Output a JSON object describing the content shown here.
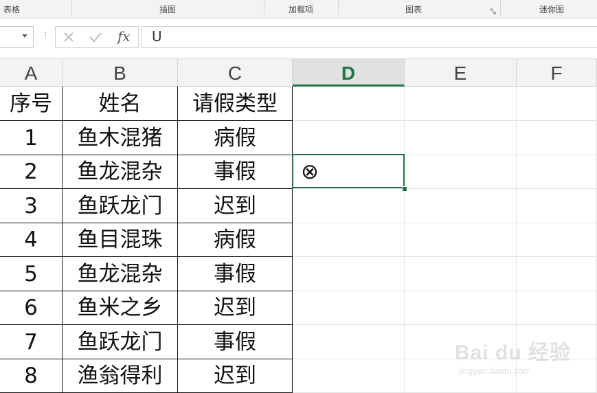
{
  "ribbon": {
    "groups": [
      "表格",
      "插图",
      "加载项",
      "图表",
      "迷你图"
    ]
  },
  "formula_bar": {
    "name_box": "",
    "cancel_icon": "x-icon",
    "enter_icon": "check-icon",
    "fx_label": "fx",
    "content": "U"
  },
  "columns": [
    "A",
    "B",
    "C",
    "D",
    "E",
    "F"
  ],
  "active_column": "D",
  "rows": [
    [
      "序号",
      "姓名",
      "请假类型",
      "",
      "",
      ""
    ],
    [
      "1",
      "鱼木混猪",
      "病假",
      "",
      "",
      ""
    ],
    [
      "2",
      "鱼龙混杂",
      "事假",
      "⊗",
      "",
      ""
    ],
    [
      "3",
      "鱼跃龙门",
      "迟到",
      "",
      "",
      ""
    ],
    [
      "4",
      "鱼目混珠",
      "病假",
      "",
      "",
      ""
    ],
    [
      "5",
      "鱼龙混杂",
      "事假",
      "",
      "",
      ""
    ],
    [
      "6",
      "鱼米之乡",
      "迟到",
      "",
      "",
      ""
    ],
    [
      "7",
      "鱼跃龙门",
      "事假",
      "",
      "",
      ""
    ],
    [
      "8",
      "渔翁得利",
      "迟到",
      "",
      "",
      ""
    ]
  ],
  "watermark": {
    "text": "Bai du 经验",
    "sub": "jingyan.baidu.com"
  },
  "colors": {
    "accent": "#217346",
    "header_bg": "#f3f3f3"
  }
}
